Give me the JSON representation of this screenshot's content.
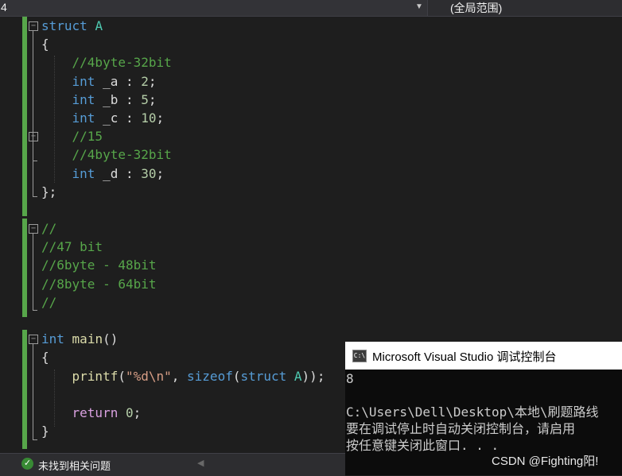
{
  "toolbar": {
    "left_dropdown_value": "4",
    "scope_label": "(全局范围)"
  },
  "code_lines": [
    [
      {
        "t": "struct ",
        "c": "kw"
      },
      {
        "t": "A",
        "c": "ty"
      }
    ],
    [
      {
        "t": "{",
        "c": ""
      }
    ],
    [
      {
        "t": "    //4byte-32bit",
        "c": "cm"
      }
    ],
    [
      {
        "t": "    ",
        "c": ""
      },
      {
        "t": "int",
        "c": "kw"
      },
      {
        "t": " _a : ",
        "c": ""
      },
      {
        "t": "2",
        "c": "nm"
      },
      {
        "t": ";",
        "c": ""
      }
    ],
    [
      {
        "t": "    ",
        "c": ""
      },
      {
        "t": "int",
        "c": "kw"
      },
      {
        "t": " _b : ",
        "c": ""
      },
      {
        "t": "5",
        "c": "nm"
      },
      {
        "t": ";",
        "c": ""
      }
    ],
    [
      {
        "t": "    ",
        "c": ""
      },
      {
        "t": "int",
        "c": "kw"
      },
      {
        "t": " _c : ",
        "c": ""
      },
      {
        "t": "10",
        "c": "nm"
      },
      {
        "t": ";",
        "c": ""
      }
    ],
    [
      {
        "t": "    //15",
        "c": "cm"
      }
    ],
    [
      {
        "t": "    //4byte-32bit",
        "c": "cm"
      }
    ],
    [
      {
        "t": "    ",
        "c": ""
      },
      {
        "t": "int",
        "c": "kw"
      },
      {
        "t": " _d : ",
        "c": ""
      },
      {
        "t": "30",
        "c": "nm"
      },
      {
        "t": ";",
        "c": ""
      }
    ],
    [
      {
        "t": "};",
        "c": ""
      }
    ],
    [],
    [
      {
        "t": "//",
        "c": "cm"
      }
    ],
    [
      {
        "t": "//47 bit",
        "c": "cm"
      }
    ],
    [
      {
        "t": "//6byte - 48bit",
        "c": "cm"
      }
    ],
    [
      {
        "t": "//8byte - 64bit",
        "c": "cm"
      }
    ],
    [
      {
        "t": "//",
        "c": "cm"
      }
    ],
    [],
    [
      {
        "t": "int",
        "c": "kw"
      },
      {
        "t": " ",
        "c": ""
      },
      {
        "t": "main",
        "c": "fn"
      },
      {
        "t": "()",
        "c": ""
      }
    ],
    [
      {
        "t": "{",
        "c": ""
      }
    ],
    [
      {
        "t": "    ",
        "c": ""
      },
      {
        "t": "printf",
        "c": "fn"
      },
      {
        "t": "(",
        "c": ""
      },
      {
        "t": "\"%d\\n\"",
        "c": "st"
      },
      {
        "t": ", ",
        "c": ""
      },
      {
        "t": "sizeof",
        "c": "kw"
      },
      {
        "t": "(",
        "c": ""
      },
      {
        "t": "struct",
        "c": "kw"
      },
      {
        "t": " ",
        "c": ""
      },
      {
        "t": "A",
        "c": "ty"
      },
      {
        "t": "));",
        "c": ""
      }
    ],
    [],
    [
      {
        "t": "    ",
        "c": ""
      },
      {
        "t": "return",
        "c": "ctl"
      },
      {
        "t": " ",
        "c": ""
      },
      {
        "t": "0",
        "c": "nm"
      },
      {
        "t": ";",
        "c": ""
      }
    ],
    [
      {
        "t": "}",
        "c": ""
      }
    ]
  ],
  "status": {
    "ok_icon": "check-circle-icon",
    "message": "未找到相关问题"
  },
  "console": {
    "icon": "console-app-icon",
    "icon_text": "C:\\",
    "title": "Microsoft Visual Studio 调试控制台",
    "output_lines": [
      "8",
      "",
      "C:\\Users\\Dell\\Desktop\\本地\\刷题路线",
      "要在调试停止时自动关闭控制台，请启用",
      "按任意键关闭此窗口. . ."
    ]
  },
  "watermark": "CSDN @Fighting阳!"
}
